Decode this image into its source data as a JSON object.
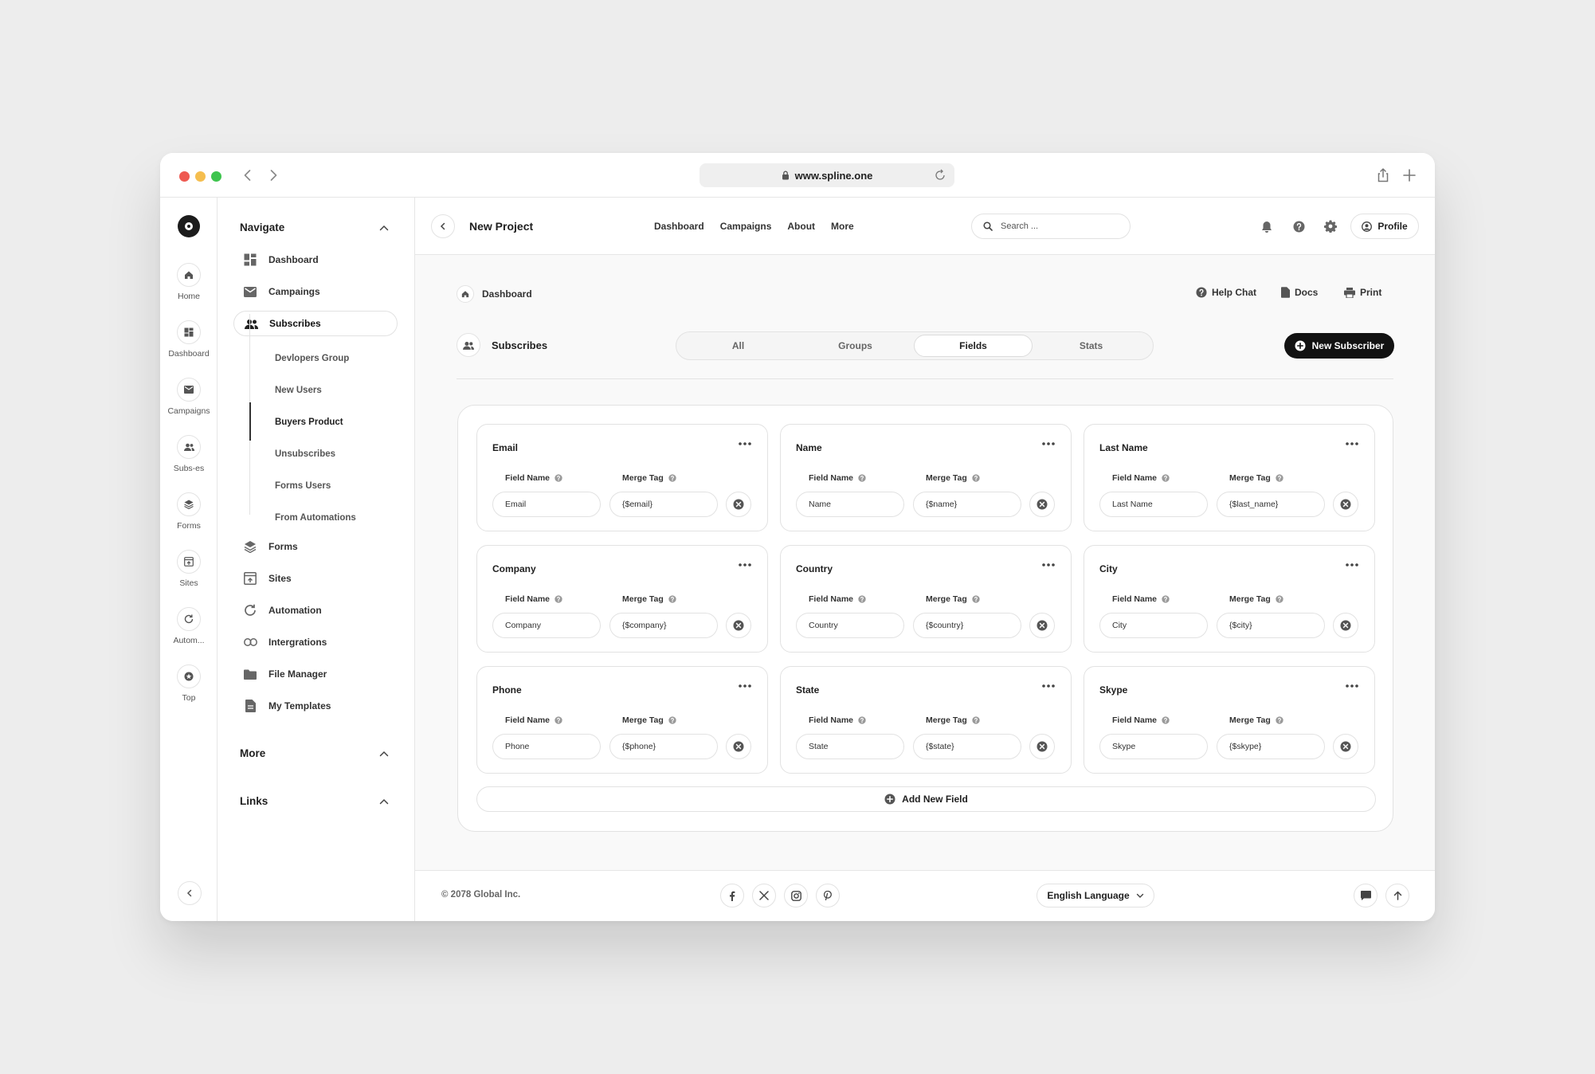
{
  "browser": {
    "url": "www.spline.one",
    "traffic_lights": {
      "close": "#ee5a52",
      "minimize": "#f5be4f",
      "maximize": "#3ec44e"
    }
  },
  "rail": {
    "items": [
      {
        "label": "Home",
        "icon": "home-icon"
      },
      {
        "label": "Dashboard",
        "icon": "dashboard-icon"
      },
      {
        "label": "Campaigns",
        "icon": "mail-icon"
      },
      {
        "label": "Subs-es",
        "icon": "users-icon"
      },
      {
        "label": "Forms",
        "icon": "layers-icon"
      },
      {
        "label": "Sites",
        "icon": "sites-icon"
      },
      {
        "label": "Autom...",
        "icon": "refresh-icon"
      },
      {
        "label": "Top",
        "icon": "star-icon"
      }
    ]
  },
  "sidebar": {
    "navigate_title": "Navigate",
    "items": [
      {
        "label": "Dashboard",
        "icon": "dashboard-icon"
      },
      {
        "label": "Campaings",
        "icon": "mail-icon"
      },
      {
        "label": "Subscribes",
        "icon": "users-icon",
        "active": true
      },
      {
        "label": "Forms",
        "icon": "layers-icon"
      },
      {
        "label": "Sites",
        "icon": "sites-icon"
      },
      {
        "label": "Automation",
        "icon": "refresh-icon"
      },
      {
        "label": "Intergrations",
        "icon": "link-icon"
      },
      {
        "label": "File Manager",
        "icon": "folder-icon"
      },
      {
        "label": "My Templates",
        "icon": "file-icon"
      }
    ],
    "sub_items": [
      {
        "label": "Devlopers Group"
      },
      {
        "label": "New Users"
      },
      {
        "label": "Buyers Product",
        "active": true
      },
      {
        "label": "Unsubscribes"
      },
      {
        "label": "Forms Users"
      },
      {
        "label": "From Automations"
      }
    ],
    "more_title": "More",
    "links_title": "Links"
  },
  "topbar": {
    "project_title": "New Project",
    "nav": [
      "Dashboard",
      "Campaigns",
      "About",
      "More"
    ],
    "search_placeholder": "Search ...",
    "profile_label": "Profile"
  },
  "breadcrumb": {
    "label": "Dashboard"
  },
  "utilities": {
    "help": "Help Chat",
    "docs": "Docs",
    "print": "Print"
  },
  "section": {
    "title": "Subscribes",
    "tabs": [
      {
        "label": "All"
      },
      {
        "label": "Groups"
      },
      {
        "label": "Fields",
        "active": true
      },
      {
        "label": "Stats"
      }
    ],
    "new_button": "New Subscriber"
  },
  "fields": {
    "field_name_label": "Field Name",
    "merge_tag_label": "Merge Tag",
    "cards": [
      {
        "title": "Email",
        "name": "Email",
        "tag": "{$email}"
      },
      {
        "title": "Name",
        "name": "Name",
        "tag": "{$name}"
      },
      {
        "title": "Last Name",
        "name": "Last Name",
        "tag": "{$last_name}"
      },
      {
        "title": "Company",
        "name": "Company",
        "tag": "{$company}"
      },
      {
        "title": "Country",
        "name": "Country",
        "tag": "{$country}"
      },
      {
        "title": "City",
        "name": "City",
        "tag": "{$city}"
      },
      {
        "title": "Phone",
        "name": "Phone",
        "tag": "{$phone}"
      },
      {
        "title": "State",
        "name": "State",
        "tag": "{$state}"
      },
      {
        "title": "Skype",
        "name": "Skype",
        "tag": "{$skype}"
      }
    ],
    "add_label": "Add New Field"
  },
  "footer": {
    "copyright": "© 2078 Global Inc.",
    "language": "English Language"
  }
}
